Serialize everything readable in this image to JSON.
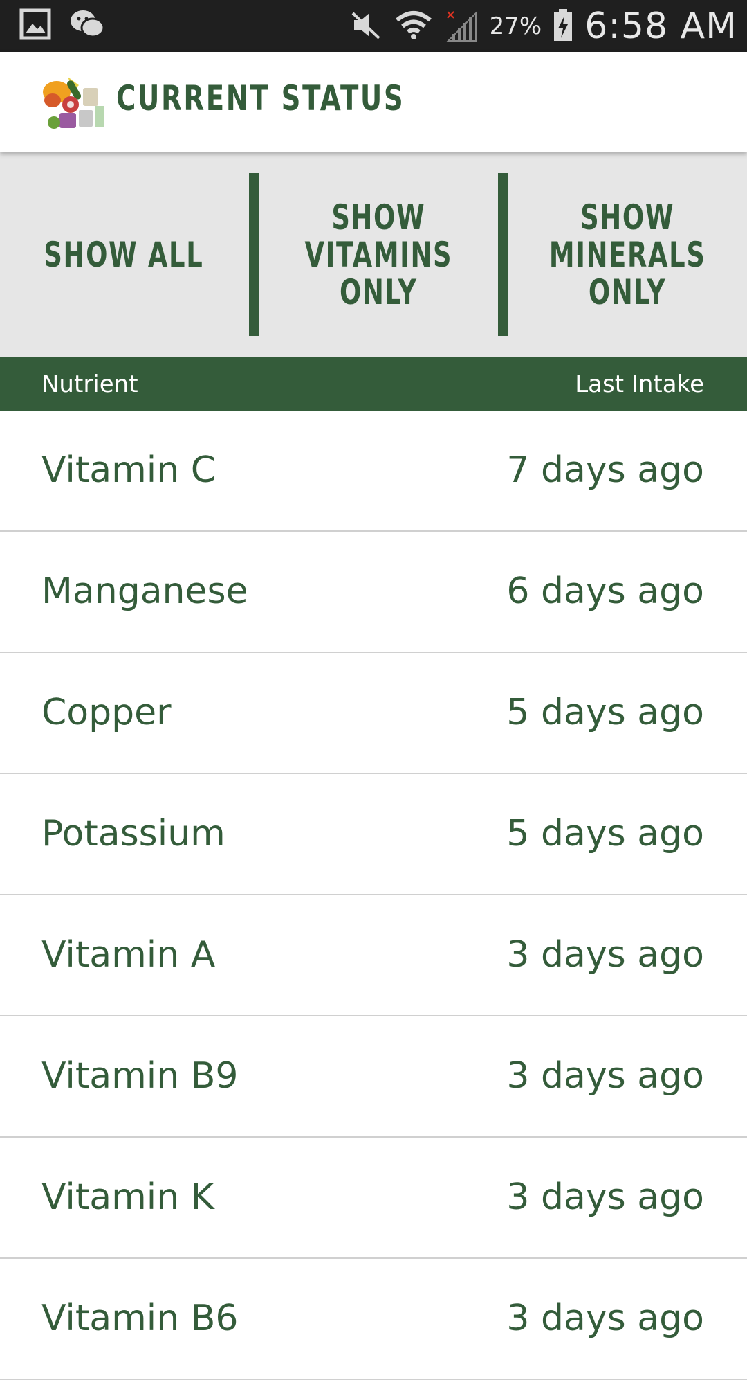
{
  "status_bar": {
    "battery": "27%",
    "time": "6:58 AM",
    "icons": [
      "gallery-icon",
      "wechat-icon",
      "mute-icon",
      "wifi-icon",
      "signal-icon",
      "battery-charging-icon"
    ]
  },
  "header": {
    "title": "CURRENT STATUS",
    "logo": "food-collage-logo"
  },
  "filters": [
    {
      "label": "SHOW ALL"
    },
    {
      "label": "SHOW\nVITAMINS\nONLY"
    },
    {
      "label": "SHOW\nMINERALS\nONLY"
    }
  ],
  "table": {
    "columns": {
      "nutrient": "Nutrient",
      "last_intake": "Last Intake"
    },
    "rows": [
      {
        "name": "Vitamin C",
        "last_intake": "7 days ago"
      },
      {
        "name": "Manganese",
        "last_intake": "6 days ago"
      },
      {
        "name": "Copper",
        "last_intake": "5 days ago"
      },
      {
        "name": "Potassium",
        "last_intake": "5 days ago"
      },
      {
        "name": "Vitamin A",
        "last_intake": "3 days ago"
      },
      {
        "name": "Vitamin B9",
        "last_intake": "3 days ago"
      },
      {
        "name": "Vitamin K",
        "last_intake": "3 days ago"
      },
      {
        "name": "Vitamin B6",
        "last_intake": "3 days ago"
      }
    ]
  },
  "colors": {
    "brand_green": "#345c3a",
    "filter_bg": "#e6e6e6",
    "status_bar_bg": "#1f1f1f"
  }
}
